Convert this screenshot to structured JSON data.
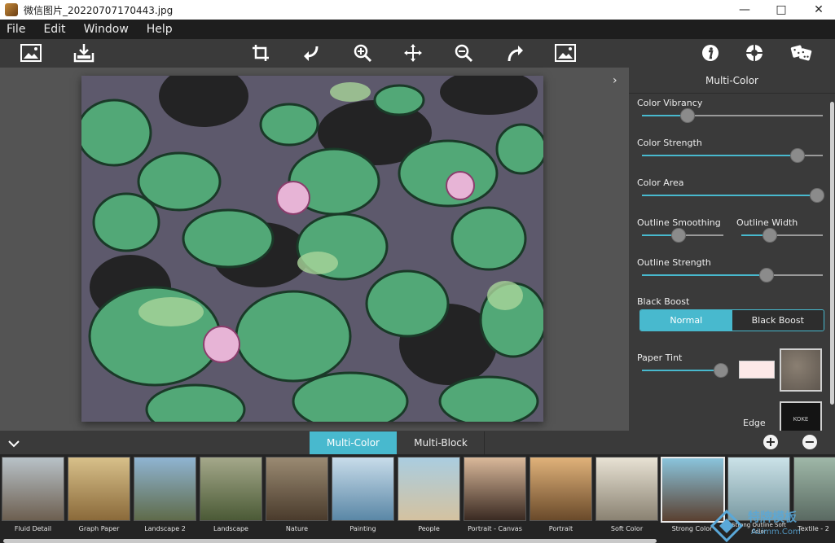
{
  "window": {
    "title": "微信图片_20220707170443.jpg",
    "minimize": "—",
    "maximize": "□",
    "close": "✕"
  },
  "menu": [
    "File",
    "Edit",
    "Window",
    "Help"
  ],
  "toolbar": {
    "left": [
      "image-icon",
      "save-icon"
    ],
    "center": [
      "crop-icon",
      "rotate-left-icon",
      "zoom-in-icon",
      "pan-icon",
      "zoom-out-icon",
      "rotate-right-icon",
      "fit-image-icon"
    ],
    "right": [
      "info-icon",
      "support-icon",
      "random-icon"
    ]
  },
  "panel": {
    "title": "Multi-Color",
    "sliders": {
      "color_vibrancy": {
        "label": "Color Vibrancy",
        "value": 0.25
      },
      "color_strength": {
        "label": "Color Strength",
        "value": 0.86
      },
      "color_area": {
        "label": "Color Area",
        "value": 0.97
      },
      "outline_smoothing": {
        "label": "Outline Smoothing",
        "value": 0.45
      },
      "outline_width": {
        "label": "Outline Width",
        "value": 0.35
      },
      "outline_strength": {
        "label": "Outline Strength",
        "value": 0.69
      },
      "paper_tint": {
        "label": "Paper Tint",
        "value": 0.99
      }
    },
    "black_boost": {
      "label": "Black Boost",
      "options": [
        "Normal",
        "Black Boost"
      ],
      "selected": "Normal"
    },
    "paper_tint_color": "#fde9e8",
    "edge_label": "Edge",
    "edge_thumb_text": "KOKE"
  },
  "tabs": {
    "items": [
      "Multi-Color",
      "Multi-Block"
    ],
    "selected": "Multi-Color",
    "add": "+",
    "remove": "−"
  },
  "presets": [
    {
      "label": "Fluid Detail"
    },
    {
      "label": "Graph Paper"
    },
    {
      "label": "Landscape 2"
    },
    {
      "label": "Landscape"
    },
    {
      "label": "Nature"
    },
    {
      "label": "Painting"
    },
    {
      "label": "People"
    },
    {
      "label": "Portrait - Canvas"
    },
    {
      "label": "Portrait"
    },
    {
      "label": "Soft Color"
    },
    {
      "label": "Strong Color",
      "selected": true
    },
    {
      "label": "Strong Outline Soft Color"
    },
    {
      "label": "Textile - 2"
    }
  ],
  "watermark": {
    "text": "特牌模板",
    "url": "ALimm.Com"
  },
  "colors": {
    "accent": "#48b9ce",
    "panel": "#3a3a3a",
    "canvas": "#545454"
  }
}
